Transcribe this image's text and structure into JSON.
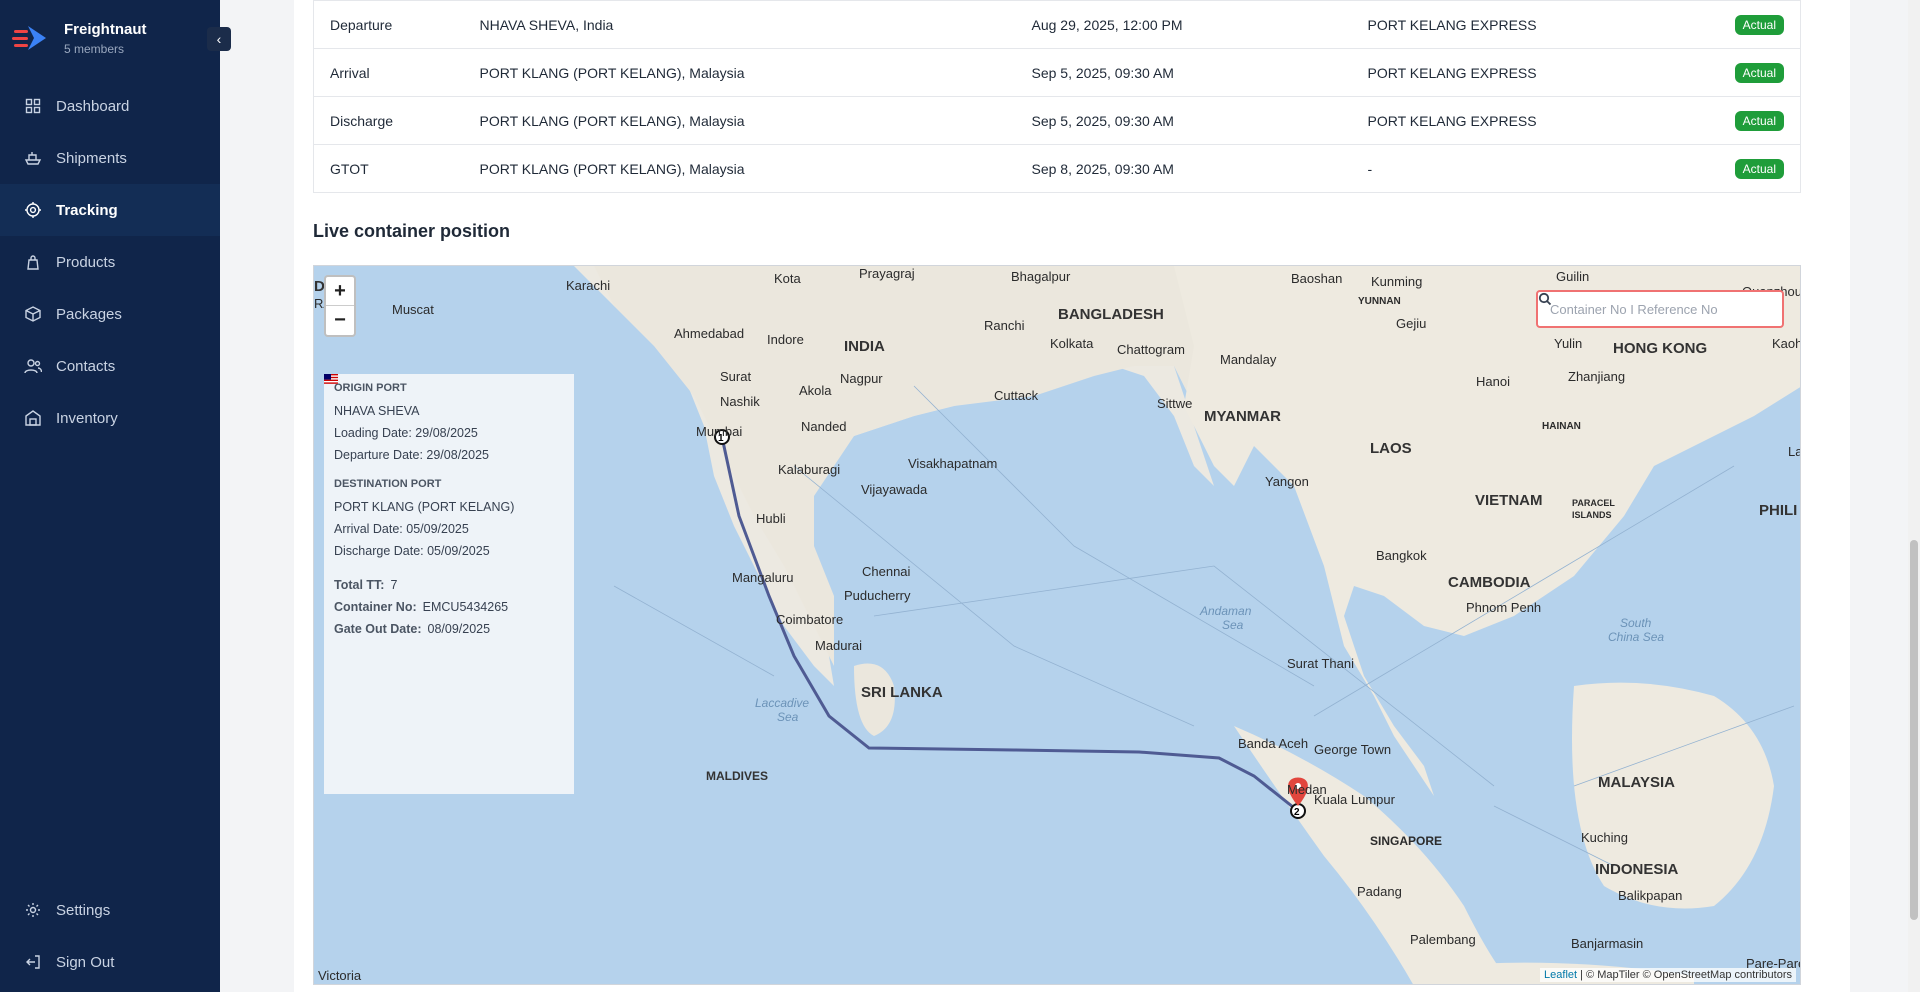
{
  "brand": {
    "name": "Freightnaut",
    "members": "5 members"
  },
  "nav": [
    {
      "label": "Dashboard",
      "icon": "dashboard-icon"
    },
    {
      "label": "Shipments",
      "icon": "ship-icon"
    },
    {
      "label": "Tracking",
      "icon": "tracking-icon",
      "active": true
    },
    {
      "label": "Products",
      "icon": "products-icon"
    },
    {
      "label": "Packages",
      "icon": "package-icon"
    },
    {
      "label": "Contacts",
      "icon": "contacts-icon"
    },
    {
      "label": "Inventory",
      "icon": "inventory-icon"
    }
  ],
  "nav_bottom": [
    {
      "label": "Settings",
      "icon": "gear-icon"
    },
    {
      "label": "Sign Out",
      "icon": "sign-out-icon"
    }
  ],
  "events": [
    {
      "event": "Departure",
      "location": "NHAVA SHEVA, India",
      "date": "Aug 29, 2025, 12:00 PM",
      "vessel": "PORT KELANG EXPRESS",
      "status": "Actual"
    },
    {
      "event": "Arrival",
      "location": "PORT KLANG (PORT KELANG), Malaysia",
      "date": "Sep 5, 2025, 09:30 AM",
      "vessel": "PORT KELANG EXPRESS",
      "status": "Actual"
    },
    {
      "event": "Discharge",
      "location": "PORT KLANG (PORT KELANG), Malaysia",
      "date": "Sep 5, 2025, 09:30 AM",
      "vessel": "PORT KELANG EXPRESS",
      "status": "Actual"
    },
    {
      "event": "GTOT",
      "location": "PORT KLANG (PORT KELANG), Malaysia",
      "date": "Sep 8, 2025, 09:30 AM",
      "vessel": "-",
      "status": "Actual"
    }
  ],
  "map_section": {
    "title": "Live container position",
    "search_placeholder": "Container No I Reference No",
    "zoom_in": "+",
    "zoom_out": "−",
    "attribution_leaflet": "Leaflet",
    "attribution_rest": " | © MapTiler © OpenStreetMap contributors"
  },
  "info": {
    "origin_header": "ORIGIN PORT",
    "origin_port": "NHAVA SHEVA",
    "loading_date": "Loading Date: 29/08/2025",
    "departure_date": "Departure Date: 29/08/2025",
    "destination_header": "DESTINATION PORT",
    "destination_port": "PORT KLANG (PORT KELANG)",
    "arrival_date": "Arrival Date: 05/09/2025",
    "discharge_date": "Discharge Date: 05/09/2025",
    "total_tt_label": "Total TT:",
    "total_tt": "7",
    "container_label": "Container No:",
    "container_no": "EMCU5434265",
    "gate_out_label": "Gate Out Date:",
    "gate_out": "08/09/2025"
  },
  "map_labels": {
    "dub": "D  B",
    "ra": "RA",
    "muscat": "Muscat",
    "karachi": "Karachi",
    "kota": "Kota",
    "prayagraj": "Prayagraj",
    "bhagalpur": "Bhagalpur",
    "baoshan": "Baoshan",
    "kunming": "Kunming",
    "guilin": "Guilin",
    "quanzhou": "Quanzhou",
    "yunnan": "YUNNAN",
    "ahmedabad": "Ahmedabad",
    "indore": "Indore",
    "india": "INDIA",
    "ranchi": "Ranchi",
    "bangladesh": "BANGLADESH",
    "gejiu": "Gejiu",
    "kolkata": "Kolkata",
    "chattogram": "Chattogram",
    "mandalay": "Mandalay",
    "yulin": "Yulin",
    "hongkong": "HONG KONG",
    "kaoh": "Kaoh",
    "surat": "Surat",
    "nagpur": "Nagpur",
    "cuttack": "Cuttack",
    "zhanjiang": "Zhanjiang",
    "hanoi": "Hanoi",
    "nashik": "Nashik",
    "akola": "Akola",
    "sittwe": "Sittwe",
    "myanmar": "MYANMAR",
    "hainan": "HAINAN",
    "mumbai": "Mumbai",
    "nanded": "Nanded",
    "visakhapatnam": "Visakhapatnam",
    "laos": "LAOS",
    "kalaburagi": "Kalaburagi",
    "yangon": "Yangon",
    "vijayawada": "Vijayawada",
    "vietnam": "VIETNAM",
    "paracel": "PARACEL",
    "islands": "ISLANDS",
    "phil": "PHILI",
    "hubli": "Hubli",
    "bangkok": "Bangkok",
    "la": "La",
    "chennai": "Chennai",
    "mangaluru": "Mangaluru",
    "cambodia": "CAMBODIA",
    "puducherry": "Puducherry",
    "andaman": "Andaman",
    "sea1": "Sea",
    "phnompenh": "Phnom Penh",
    "coimbatore": "Coimbatore",
    "madurai": "Madurai",
    "south": "South",
    "chinasea": "China Sea",
    "suratthani": "Surat Thani",
    "srilanka": "SRI LANKA",
    "laccadive": "Laccadive",
    "sea2": "Sea",
    "bandaaceh": "Banda Aceh",
    "georgetown": "George Town",
    "maldives": "MALDIVES",
    "malaysia": "MALAYSIA",
    "medan": "Medan",
    "kualalumpur": "Kuala Lumpur",
    "singapore": "SINGAPORE",
    "kuching": "Kuching",
    "indonesia": "INDONESIA",
    "padang": "Padang",
    "balikpapan": "Balikpapan",
    "palembang": "Palembang",
    "banjarmasin": "Banjarmasin",
    "parepare": "Pare-Pare",
    "victoria": "Victoria",
    "marker1": "1",
    "marker2": "2"
  },
  "colors": {
    "sidebar": "#10254a",
    "route": "#4f5b93",
    "badge": "#1f9d3a",
    "pin": "#e2463d"
  }
}
